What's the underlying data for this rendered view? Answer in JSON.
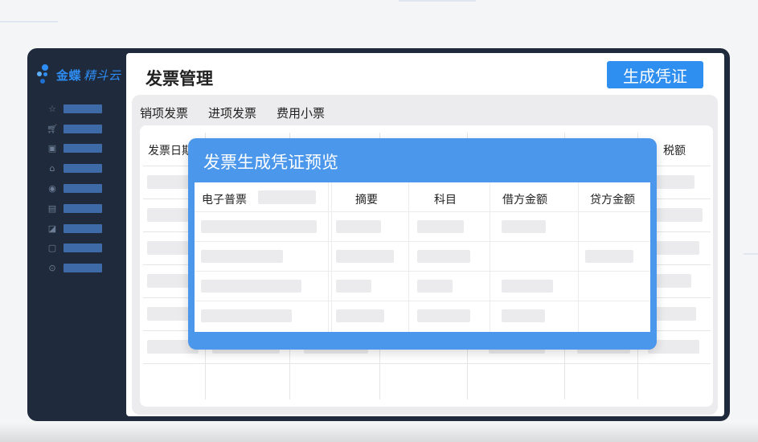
{
  "app": {
    "brand_name": "金蝶",
    "brand_product": "精斗云"
  },
  "sidebar": {
    "icons": [
      "star-icon",
      "cart-icon",
      "image-icon",
      "home-icon",
      "target-icon",
      "document-icon",
      "chart-icon",
      "inbox-icon",
      "settings-icon"
    ]
  },
  "page": {
    "title": "发票管理",
    "generate_button": "生成凭证"
  },
  "tabs": [
    "销项发票",
    "进项发票",
    "费用小票"
  ],
  "bg_table": {
    "headers": [
      "发票日期",
      "税额"
    ]
  },
  "modal": {
    "title": "发票生成凭证预览",
    "headers": [
      "电子普票",
      "摘要",
      "科目",
      "借方金额",
      "贷方金额"
    ]
  },
  "colors": {
    "accent": "#2f8ff0",
    "sidebar_bg": "#1f2b3c",
    "modal_header": "#4b97ec",
    "brand": "#2e8df5"
  }
}
